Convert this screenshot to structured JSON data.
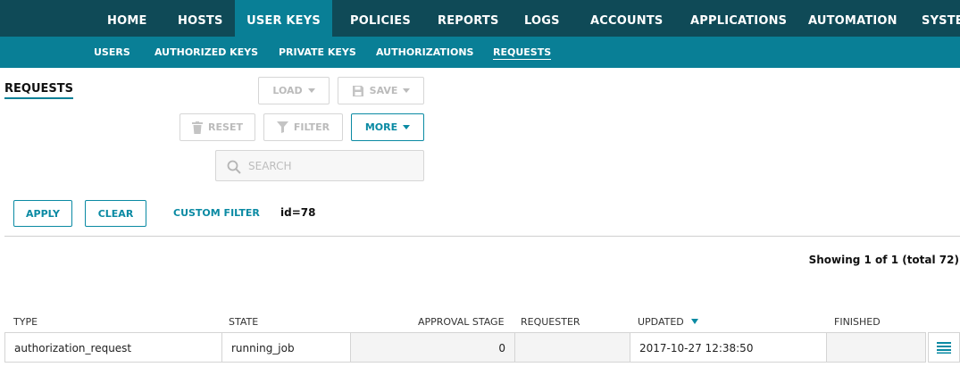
{
  "topnav": {
    "items": [
      "HOME",
      "HOSTS",
      "USER KEYS",
      "POLICIES",
      "REPORTS",
      "LOGS",
      "ACCOUNTS",
      "APPLICATIONS",
      "AUTOMATION",
      "SYSTEM"
    ],
    "active_index": 2
  },
  "subnav": {
    "items": [
      "USERS",
      "AUTHORIZED KEYS",
      "PRIVATE KEYS",
      "AUTHORIZATIONS",
      "REQUESTS"
    ],
    "active_index": 4
  },
  "page_title": "REQUESTS",
  "toolbar": {
    "load_label": "LOAD",
    "save_label": "SAVE",
    "reset_label": "RESET",
    "filter_label": "FILTER",
    "more_label": "MORE"
  },
  "search": {
    "placeholder": "SEARCH",
    "value": ""
  },
  "filter_bar": {
    "apply_label": "APPLY",
    "clear_label": "CLEAR",
    "custom_filter_label": "CUSTOM FILTER",
    "expression": "id=78"
  },
  "results": {
    "showing_text": "Showing 1 of 1 (total 72)"
  },
  "table": {
    "columns": [
      "TYPE",
      "STATE",
      "APPROVAL STAGE",
      "REQUESTER",
      "UPDATED",
      "FINISHED"
    ],
    "sorted_column": "UPDATED",
    "sort_direction": "descending",
    "rows": [
      {
        "type": "authorization_request",
        "state": "running_job",
        "approval_stage": "0",
        "requester": "",
        "updated": "2017-10-27 12:38:50",
        "finished": ""
      }
    ]
  },
  "icons": {
    "save": "save-icon",
    "reset": "trash-icon",
    "filter": "funnel-icon",
    "search": "search-icon",
    "row_menu": "list-menu-icon"
  },
  "colors": {
    "topnav_bg": "#0f4a57",
    "accent": "#097f96",
    "link": "#0a8aa3"
  }
}
